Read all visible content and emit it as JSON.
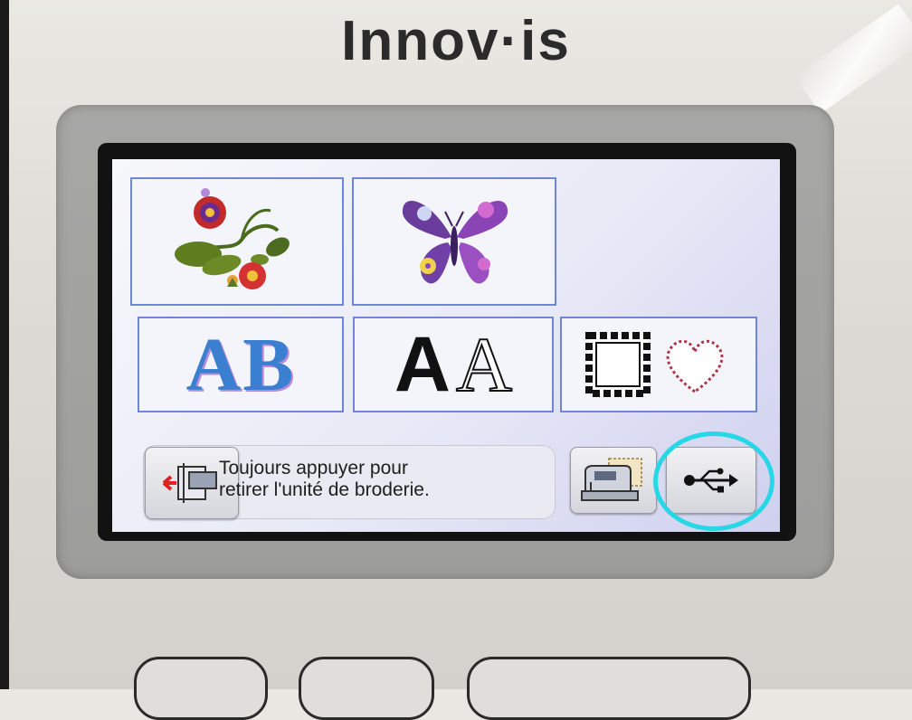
{
  "device": {
    "brand": "Innov·is"
  },
  "screen": {
    "tiles": [
      {
        "id": "floral",
        "icon": "floral-embroidery-icon"
      },
      {
        "id": "butterfly",
        "icon": "butterfly-embroidery-icon"
      },
      {
        "id": "decorative-alphabet",
        "icon": "decorative-alphabet-icon",
        "text": "AB"
      },
      {
        "id": "font-alphabet",
        "icon": "character-font-icon",
        "text_bold": "A",
        "text_outline": "A"
      },
      {
        "id": "frames",
        "icon": "frame-pattern-icon"
      }
    ],
    "status": {
      "line1": "Toujours appuyer pour",
      "line2": "retirer l'unité de broderie."
    },
    "buttons": {
      "remove_unit_icon": "embroidery-unit-remove-icon",
      "machine_icon": "sewing-machine-icon",
      "usb_icon": "usb-icon"
    },
    "highlight_color": "#26d7e6",
    "tile_border_color": "#6f86d6"
  }
}
